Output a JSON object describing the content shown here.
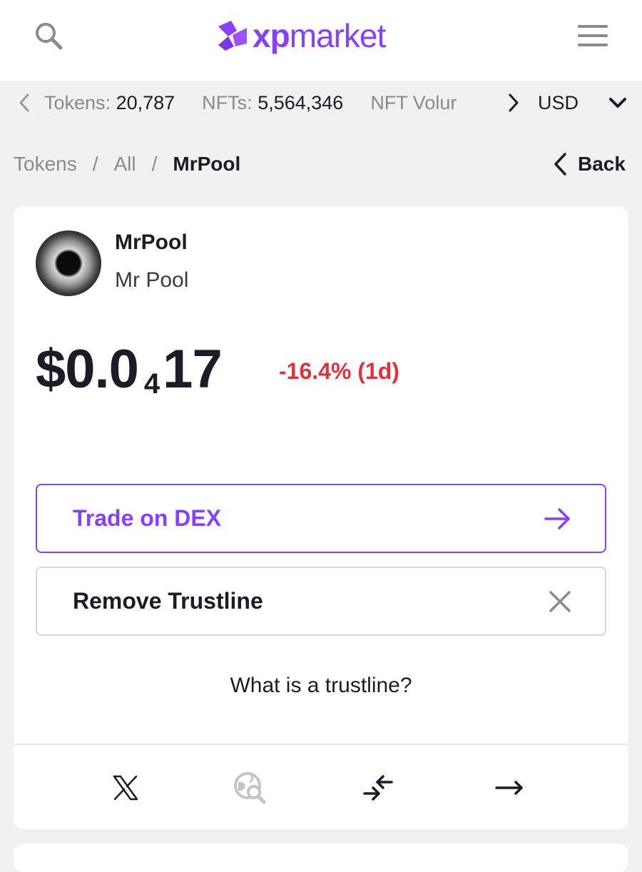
{
  "header": {
    "logo_text_bold": "xp",
    "logo_text_light": "market",
    "icons": {
      "search": "search-icon",
      "menu": "hamburger-menu-icon"
    },
    "brand_color": "#8a3ffc"
  },
  "ticker": {
    "stats": [
      {
        "label": "Tokens:",
        "value": "20,787"
      },
      {
        "label": "NFTs:",
        "value": "5,564,346"
      },
      {
        "label": "NFT Volur",
        "value": ""
      }
    ],
    "currency": "USD"
  },
  "breadcrumb": {
    "items": [
      "Tokens",
      "All"
    ],
    "separator": "/",
    "current": "MrPool",
    "back_label": "Back"
  },
  "token": {
    "symbol": "MrPool",
    "name": "Mr Pool",
    "price_main": "$0.0",
    "price_zero_count": "4",
    "price_digits": "17",
    "change": "-16.4% (1d)",
    "change_color": "#e0323c"
  },
  "actions": {
    "trade_label": "Trade on DEX",
    "remove_label": "Remove Trustline",
    "help_link": "What is a trustline?"
  },
  "social": {
    "icons": [
      "x-icon",
      "globe-search-icon",
      "swap-arrows-icon",
      "arrow-right-icon"
    ]
  }
}
